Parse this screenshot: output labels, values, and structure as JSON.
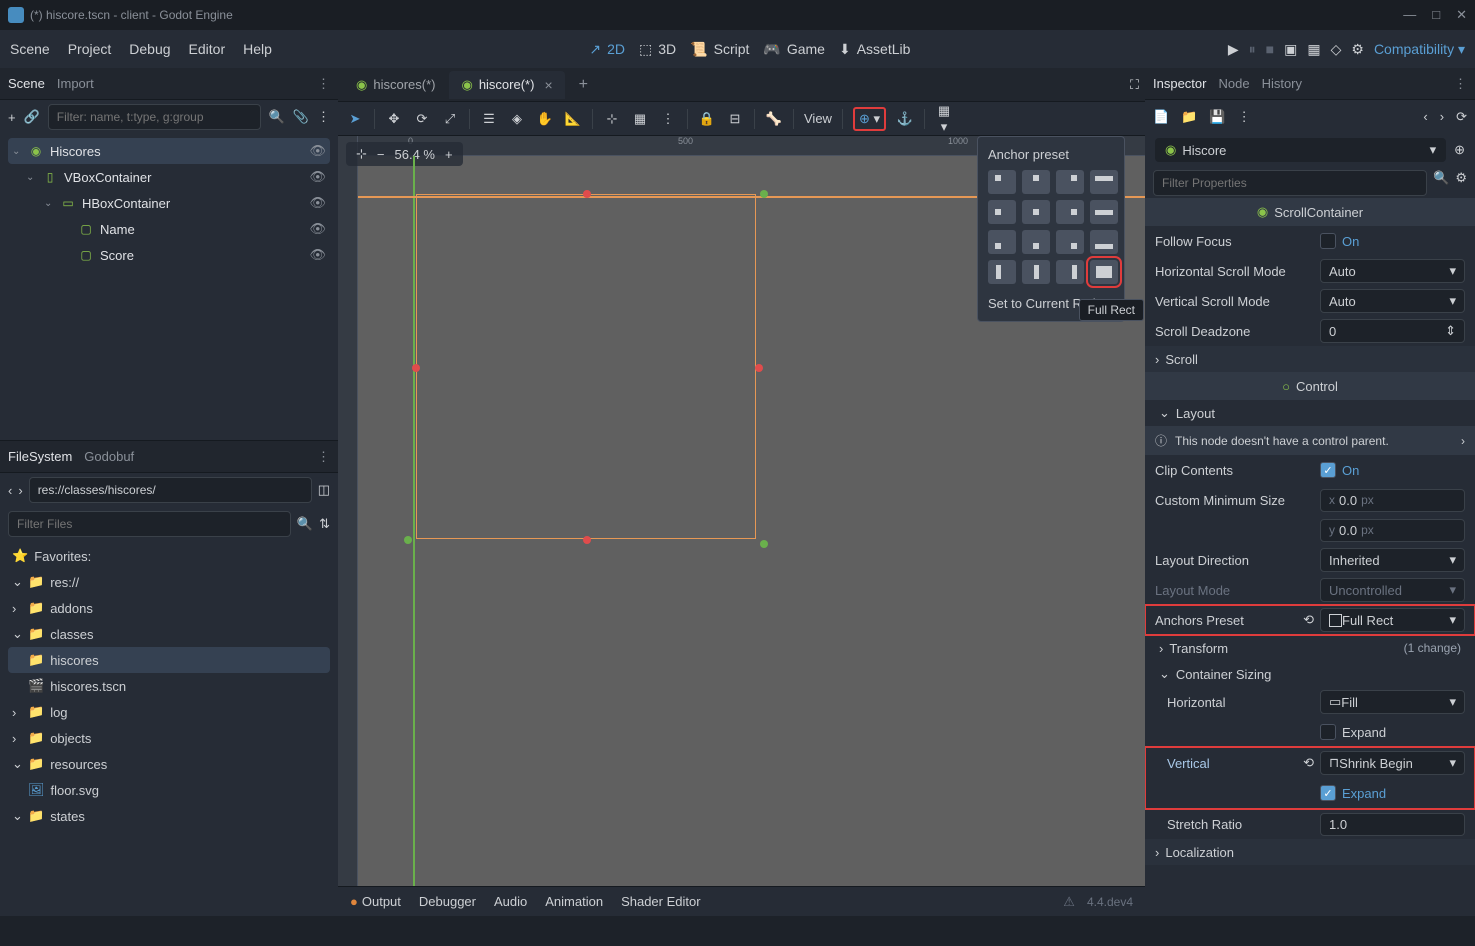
{
  "window": {
    "title": "(*) hiscore.tscn - client - Godot Engine"
  },
  "menubar": {
    "items": [
      "Scene",
      "Project",
      "Debug",
      "Editor",
      "Help"
    ]
  },
  "modes": {
    "m2d": "2D",
    "m3d": "3D",
    "script": "Script",
    "game": "Game",
    "assetlib": "AssetLib",
    "compat": "Compatibility"
  },
  "scene_panel": {
    "tabs": {
      "scene": "Scene",
      "import": "Import"
    },
    "filter_placeholder": "Filter: name, t:type, g:group",
    "tree": [
      {
        "label": "Hiscores",
        "icon_color": "#8bc34a",
        "selected": true,
        "indent": 0
      },
      {
        "label": "VBoxContainer",
        "icon_color": "#8bc34a",
        "indent": 1
      },
      {
        "label": "HBoxContainer",
        "icon_color": "#8bc34a",
        "indent": 2
      },
      {
        "label": "Name",
        "icon_color": "#8bc34a",
        "indent": 3
      },
      {
        "label": "Score",
        "icon_color": "#8bc34a",
        "indent": 3
      }
    ]
  },
  "filesystem": {
    "tabs": {
      "fs": "FileSystem",
      "other": "Godobuf"
    },
    "path": "res://classes/hiscores/",
    "filter_placeholder": "Filter Files",
    "favorites": "Favorites:",
    "tree": [
      {
        "label": "res://",
        "indent": 0
      },
      {
        "label": "addons",
        "indent": 1
      },
      {
        "label": "classes",
        "indent": 1,
        "expanded": true
      },
      {
        "label": "hiscores",
        "indent": 2,
        "selected": true
      },
      {
        "label": "hiscores.tscn",
        "indent": 3,
        "file": true
      },
      {
        "label": "log",
        "indent": 1
      },
      {
        "label": "objects",
        "indent": 1
      },
      {
        "label": "resources",
        "indent": 1
      },
      {
        "label": "floor.svg",
        "indent": 2,
        "file": true
      },
      {
        "label": "states",
        "indent": 1
      }
    ]
  },
  "center": {
    "tabs": [
      {
        "label": "hiscores(*)"
      },
      {
        "label": "hiscore(*)",
        "active": true
      }
    ],
    "zoom": "56.4 %",
    "view_btn": "View"
  },
  "anchor_popup": {
    "title": "Anchor preset",
    "tooltip": "Full Rect",
    "footer": "Set to Current Ratio"
  },
  "inspector": {
    "tabs": {
      "inspector": "Inspector",
      "node": "Node",
      "history": "History"
    },
    "object": "Hiscore",
    "filter_placeholder": "Filter Properties",
    "sections": {
      "scroll_container": "ScrollContainer",
      "control": "Control"
    },
    "props": {
      "follow_focus": {
        "label": "Follow Focus",
        "value": "On"
      },
      "h_scroll": {
        "label": "Horizontal Scroll Mode",
        "value": "Auto"
      },
      "v_scroll": {
        "label": "Vertical Scroll Mode",
        "value": "Auto"
      },
      "deadzone": {
        "label": "Scroll Deadzone",
        "value": "0"
      },
      "scroll": "Scroll",
      "layout": "Layout",
      "warning": "This node doesn't have a control parent.",
      "clip": {
        "label": "Clip Contents",
        "value": "On"
      },
      "min_size": {
        "label": "Custom Minimum Size",
        "x": "0.0",
        "y": "0.0",
        "unit": "px"
      },
      "layout_dir": {
        "label": "Layout Direction",
        "value": "Inherited"
      },
      "layout_mode": {
        "label": "Layout Mode",
        "value": "Uncontrolled"
      },
      "anchors_preset": {
        "label": "Anchors Preset",
        "value": "Full Rect"
      },
      "transform": {
        "label": "Transform",
        "changes": "(1 change)"
      },
      "container_sizing": "Container Sizing",
      "horizontal": {
        "label": "Horizontal",
        "value": "Fill",
        "expand": "Expand"
      },
      "vertical": {
        "label": "Vertical",
        "value": "Shrink Begin",
        "expand": "Expand"
      },
      "stretch": {
        "label": "Stretch Ratio",
        "value": "1.0"
      },
      "localization": "Localization"
    }
  },
  "bottom": {
    "tabs": [
      "Output",
      "Debugger",
      "Audio",
      "Animation",
      "Shader Editor"
    ],
    "version": "4.4.dev4"
  }
}
